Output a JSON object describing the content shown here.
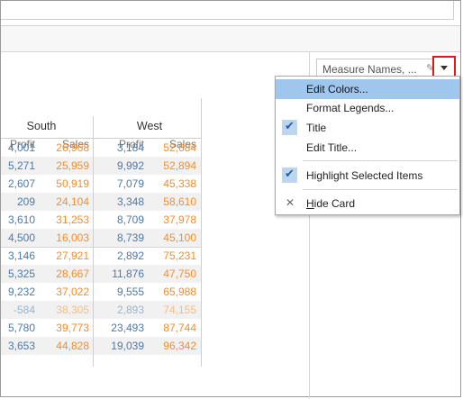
{
  "legend": {
    "title": "Measure Names, ...",
    "edit_icon": "pencil-icon",
    "dropdown_icon": "triangle-down-icon"
  },
  "table": {
    "groups": [
      "South",
      "West"
    ],
    "column_headers": [
      "Profit",
      "Sales",
      "Profit",
      "Sales"
    ],
    "rows": [
      [
        "4,001",
        "26,968",
        "3,184",
        "52,684"
      ],
      [
        "5,271",
        "25,959",
        "9,992",
        "52,894"
      ],
      [
        "2,607",
        "50,919",
        "7,079",
        "45,338"
      ],
      [
        "209",
        "24,104",
        "3,348",
        "58,610"
      ],
      [
        "3,610",
        "31,253",
        "8,709",
        "37,978"
      ],
      [
        "4,500",
        "16,003",
        "8,739",
        "45,100"
      ],
      [
        "3,146",
        "27,921",
        "2,892",
        "75,231"
      ],
      [
        "5,325",
        "28,667",
        "11,876",
        "47,750"
      ],
      [
        "9,232",
        "37,022",
        "9,555",
        "65,988"
      ],
      [
        "-584",
        "38,305",
        "2,893",
        "74,155"
      ],
      [
        "5,780",
        "39,773",
        "23,493",
        "87,744"
      ],
      [
        "3,653",
        "44,828",
        "19,039",
        "96,342"
      ]
    ],
    "colors": {
      "profit": "#4e79a7",
      "sales": "#f28e2b"
    }
  },
  "menu": {
    "items": [
      {
        "label": "Edit Colors...",
        "highlighted": true
      },
      {
        "label": "Format Legends..."
      },
      {
        "label": "Title",
        "checked": true
      },
      {
        "label": "Edit Title..."
      },
      {
        "label": "Highlight Selected Items",
        "checked": true
      },
      {
        "label_prefix": "H",
        "label_rest": "ide Card",
        "icon": "close-icon"
      }
    ]
  },
  "highlight_color": "#9fc6ec",
  "accent_red": "#e0181b"
}
